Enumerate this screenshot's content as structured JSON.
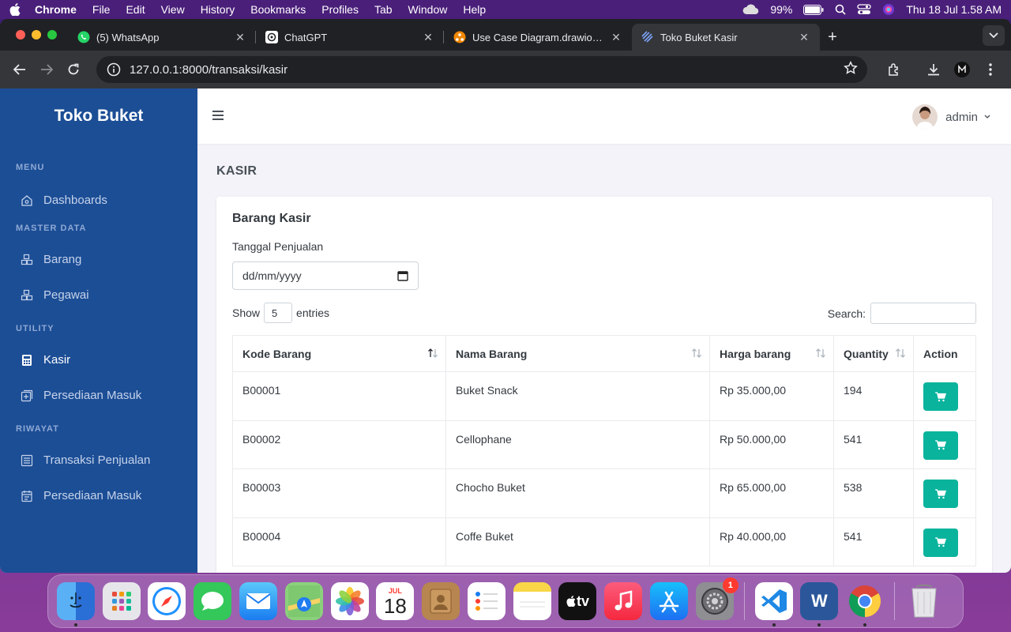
{
  "menubar": {
    "app": "Chrome",
    "items": [
      "File",
      "Edit",
      "View",
      "History",
      "Bookmarks",
      "Profiles",
      "Tab",
      "Window",
      "Help"
    ],
    "battery": "99%",
    "datetime": "Thu 18 Jul  1.58 AM"
  },
  "browser": {
    "tabs": [
      {
        "title": "(5) WhatsApp",
        "icon": "whatsapp-icon"
      },
      {
        "title": "ChatGPT",
        "icon": "chatgpt-icon"
      },
      {
        "title": "Use Case Diagram.drawio.png",
        "icon": "drawio-icon"
      },
      {
        "title": "Toko Buket Kasir",
        "icon": "site-icon",
        "active": true
      }
    ],
    "url": "127.0.0.1:8000/transaksi/kasir"
  },
  "sidebar": {
    "brand": "Toko Buket",
    "sections": [
      {
        "title": "MENU",
        "items": [
          {
            "label": "Dashboards",
            "icon": "home-icon"
          }
        ]
      },
      {
        "title": "MASTER DATA",
        "items": [
          {
            "label": "Barang",
            "icon": "cubes-icon"
          },
          {
            "label": "Pegawai",
            "icon": "cubes-icon"
          }
        ]
      },
      {
        "title": "UTILITY",
        "items": [
          {
            "label": "Kasir",
            "icon": "calculator-icon",
            "active": true
          },
          {
            "label": "Persediaan Masuk",
            "icon": "add-box-icon"
          }
        ]
      },
      {
        "title": "RIWAYAT",
        "items": [
          {
            "label": "Transaksi Penjualan",
            "icon": "list-icon"
          },
          {
            "label": "Persediaan Masuk",
            "icon": "calendar-icon"
          }
        ]
      }
    ]
  },
  "header": {
    "user": "admin"
  },
  "main": {
    "page_title": "KASIR",
    "card_title": "Barang Kasir",
    "date_label": "Tanggal Penjualan",
    "date_placeholder": "dd/mm/yyyy",
    "show_label": "Show",
    "entries_value": "5",
    "entries_label": "entries",
    "search_label": "Search:",
    "columns": [
      "Kode Barang",
      "Nama Barang",
      "Harga barang",
      "Quantity",
      "Action"
    ],
    "rows": [
      {
        "kode": "B00001",
        "nama": "Buket Snack",
        "harga": "Rp 35.000,00",
        "qty": "194"
      },
      {
        "kode": "B00002",
        "nama": "Cellophane",
        "harga": "Rp 50.000,00",
        "qty": "541"
      },
      {
        "kode": "B00003",
        "nama": "Chocho Buket",
        "harga": "Rp 65.000,00",
        "qty": "538"
      },
      {
        "kode": "B00004",
        "nama": "Coffe Buket",
        "harga": "Rp 40.000,00",
        "qty": "541"
      }
    ]
  },
  "dock": {
    "calendar_month": "JUL",
    "calendar_day": "18",
    "tv_label": "tv",
    "settings_badge": "1",
    "word_letter": "W"
  },
  "colors": {
    "sidebar": "#1c4e96",
    "accent": "#0ab39c",
    "page_bg": "#f3f3f9"
  }
}
